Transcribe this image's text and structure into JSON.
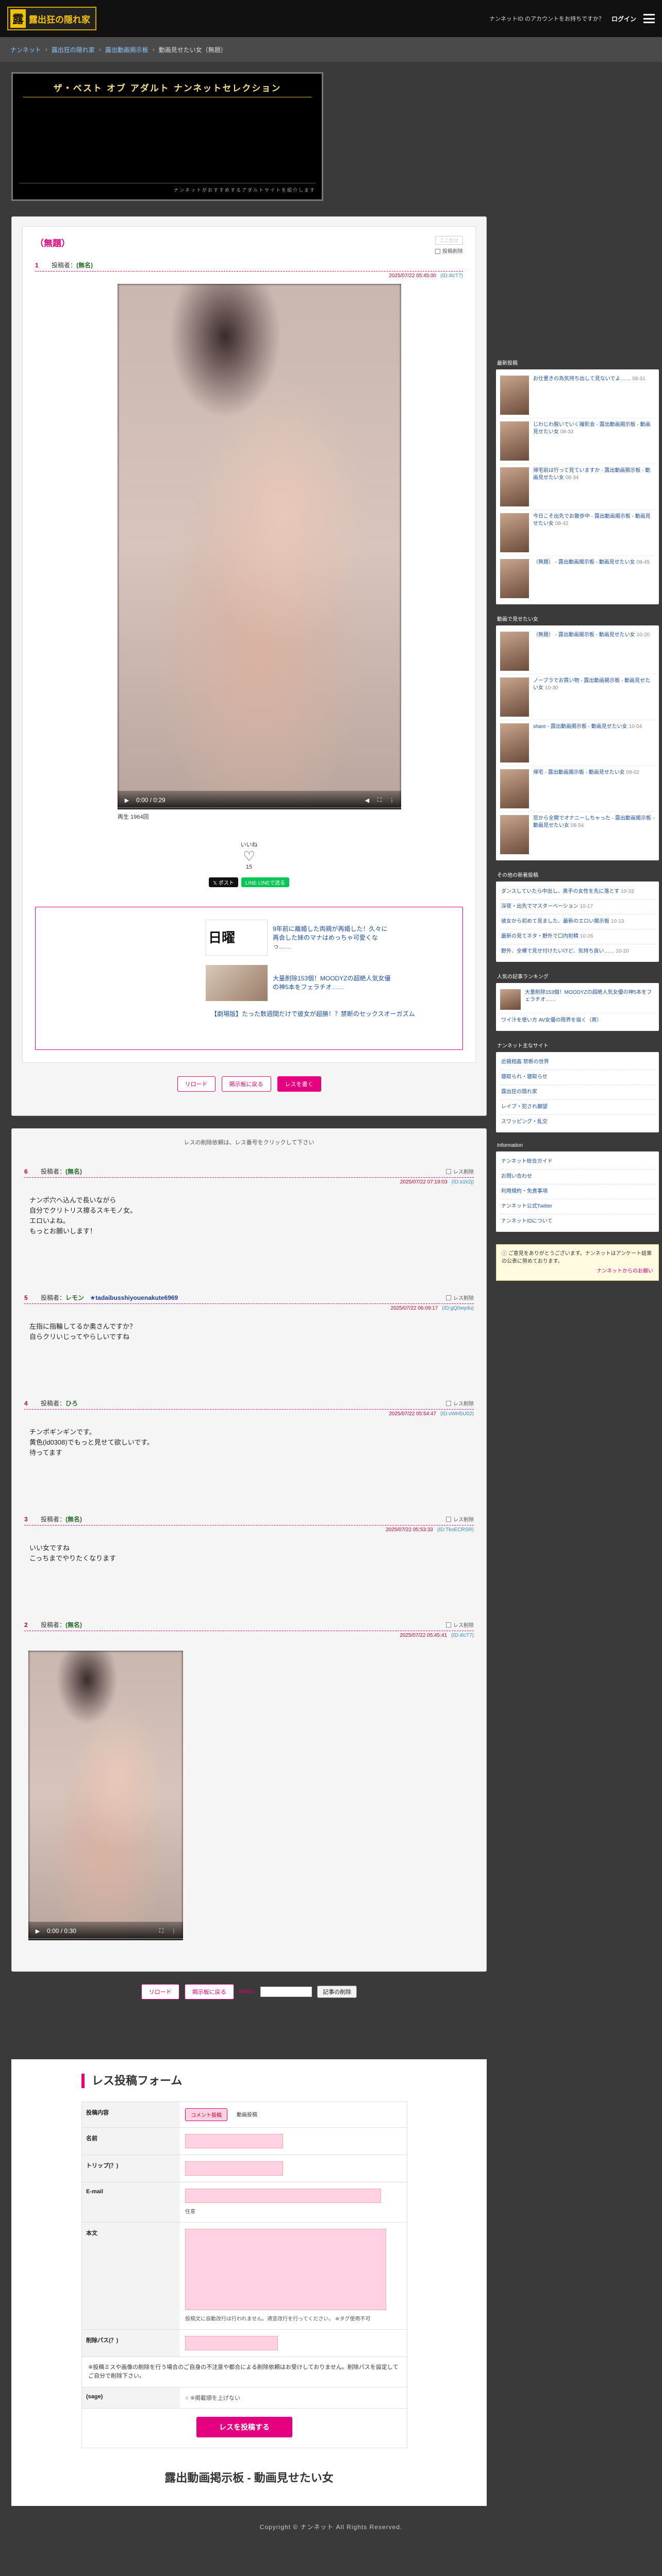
{
  "header": {
    "logo_mark": "露",
    "logo_text": "露出狂の隠れ家",
    "account_prompt": "ナンネットID のアカウントをお持ちですか？",
    "login_label": "ログイン"
  },
  "breadcrumb": [
    "ナンネット",
    "露出狂の隠れ家",
    "露出動画掲示板",
    "動画見せたい女（無題）"
  ],
  "banner": {
    "title": "ザ・ベスト オブ アダルト ナンネットセレクション",
    "strip": "ナンネットがおすすめするアダルトサイトを紹介します"
  },
  "thread": {
    "title": "（無題）",
    "option_button": "ここだけ",
    "option_check": "投稿削除",
    "post_num": "1",
    "poster_label": "投稿者：",
    "poster_name": "(無名)",
    "date": "2025/07/22 05:45:00",
    "id": "(ID:4lcT7)",
    "video_time": "0:00 / 0:29",
    "play_count": "再生 1964回",
    "like_label": "いいね",
    "like_count": "15",
    "share_x": "ポスト",
    "share_line": "LINEで送る"
  },
  "ads": {
    "kanji": "日曜",
    "ad1": "9年前に離婚した両親が再婚した！久々に再会した妹のマナはめっちゃ可愛くなっ……",
    "ad2": "大量削除153個！MOODYZの超絶人気女優の神5本をフェラチオ……",
    "ad3": "【劇場版】たった数週間だけで彼女が超勝！？禁断のセックスオーガズム"
  },
  "buttons": {
    "reload": "リロード",
    "back": "掲示板に戻る",
    "write": "レスを書く",
    "pass_label": "PASS:",
    "delete": "記事の削除"
  },
  "res_note": "レスの削除依頼は、レス番号をクリックして下さい",
  "replies": [
    {
      "num": "6",
      "poster_label": "投稿者：",
      "name": "(無名)",
      "user_id": "",
      "check": "レス削除",
      "date": "2025/07/22 07:19:03",
      "id": "(ID:a1k2j)",
      "lines": [
        "ナンポ穴へ込んで長いながら",
        "自分でクリトリス擦るスキモノ女。",
        "エロいよね。",
        "もっとお願いします！"
      ]
    },
    {
      "num": "5",
      "poster_label": "投稿者：",
      "name": "レモン",
      "user_id": "tadaibusshiyouenakute6969",
      "check": "レス削除",
      "date": "2025/07/22 06:09:17",
      "id": "(ID:gQ0wydu)",
      "lines": [
        "左指に指輪してるか奥さんですか？",
        "自らクリいじってやらしいですね"
      ]
    },
    {
      "num": "4",
      "poster_label": "投稿者：",
      "name": "ひろ",
      "user_id": "",
      "check": "レス削除",
      "date": "2025/07/22 05:54:47",
      "id": "(ID:vWH5U02)",
      "lines": [
        "チンポギンギンです。",
        "黄色(ld0308)でもっと見せて欲しいです。",
        "待ってます"
      ]
    },
    {
      "num": "3",
      "poster_label": "投稿者：",
      "name": "(無名)",
      "user_id": "",
      "check": "レス削除",
      "date": "2025/07/22 05:53:33",
      "id": "(ID:TkoECRSR)",
      "lines": [
        "いい女ですね",
        "こっちまでやりたくなります"
      ]
    },
    {
      "num": "2",
      "poster_label": "投稿者：",
      "name": "(無名)",
      "user_id": "",
      "check": "レス削除",
      "date": "2025/07/22 05:45:41",
      "id": "(ID:4lcT7)",
      "video_time": "0:00 / 0:30",
      "lines": []
    }
  ],
  "form": {
    "title": "レス投稿フォーム",
    "rows": {
      "content": "投稿内容",
      "tab_text": "コメント投稿",
      "tab_video": "動画投稿",
      "name": "名前",
      "trip": "トリップ(？)",
      "email": "E-mail",
      "email_hint": "任意",
      "body": "本文",
      "body_help": "投稿文に自動改行は行われません。適宜改行を行ってください。 ※タグ使用不可",
      "delete_pass": "削除パス(？)",
      "note": "※投稿ミスや画像の削除を行う場合のご自身の不注意や都合による削除依頼はお受けしておりません。削除パスを設定してご自分で削除下さい。",
      "sage": "(sage)",
      "sage_check": "※掲載順を上げない",
      "submit": "レスを投稿する"
    }
  },
  "board_title": "露出動画掲示板 - 動画見せたい女",
  "sidebar": {
    "section1": "最新投稿",
    "top_items": [
      {
        "text": "お仕置きの為気持ち出して見ないでよ……",
        "meta": "08-31"
      },
      {
        "text": "じわじわ脱いでいく撮影会 - 露出動画掲示板 - 動画見せたい女",
        "meta": "08-33"
      },
      {
        "text": "帰宅前は行って見ていますか - 露出動画掲示板 - 動画見せたい女",
        "meta": "08-34"
      },
      {
        "text": "今日こそ出先でお散歩中 - 露出動画掲示板 - 動画見せたい女",
        "meta": "08-42"
      },
      {
        "text": "（無題） - 露出動画掲示板 - 動画見せたい女",
        "meta": "08-45"
      }
    ],
    "section2": "動画で見せたい女",
    "mid_items": [
      {
        "text": "（無題） - 露出動画掲示板 - 動画見せたい女",
        "meta": "10-20"
      },
      {
        "text": "ノーブラでお買い物 - 露出動画掲示板 - 動画見せたい女",
        "meta": "10-30"
      },
      {
        "text": "share - 露出動画掲示板 - 動画見せたい女",
        "meta": "10-04"
      },
      {
        "text": "帰宅 - 露出動画掲示板 - 動画見せたい女",
        "meta": "09-02"
      },
      {
        "text": "窓から全開でオナニーしちゃった - 露出動画掲示板 - 動画見せたい女",
        "meta": "08-54"
      }
    ],
    "section3": "その他の新着投稿",
    "text_items": [
      {
        "text": "ダンスしていたら中出し、奥手の女性を先に落とす",
        "meta": "10-33"
      },
      {
        "text": "深夜・出先でマスターベーション",
        "meta": "10-17"
      },
      {
        "text": "彼女から初めて見ました、最新のエロい掲示板",
        "meta": "10-13"
      },
      {
        "text": "最新の見てネタ・野外で口内射精",
        "meta": "10-26"
      },
      {
        "text": "野外、全裸で見せ付けたいけど、気持ち良い……",
        "meta": "10-20"
      }
    ],
    "section4": "人気の記事ランキング",
    "rank_items": [
      {
        "text": "大量削除153個！MOODYZの超絶人気女優の神5本をフェラチオ……",
        "meta": ""
      },
      {
        "text": "ワイ汁を使い方 AV女優の限界を描く（男）",
        "meta": ""
      }
    ],
    "section5": "ナンネット主なサイト",
    "site_links": [
      "近親相姦 禁断の世界",
      "寝取られ・寝取らせ",
      "露出狂の隠れ家",
      "レイプ・犯され願望",
      "スワッピング・乱交"
    ],
    "section6": "Information",
    "info_links": [
      "ナンネット総合ガイド",
      "お問い合わせ",
      "利用規約・免責事項",
      "ナンネット公式Twitter",
      "ナンネットIDについて"
    ],
    "notice": "ご意見をありがとうございます。ナンネットはアンケート結果の公表に努めております。",
    "notice_link": "ナンネットからのお願い"
  },
  "copyright": "Copyright © ナンネット All Rights Reserved."
}
